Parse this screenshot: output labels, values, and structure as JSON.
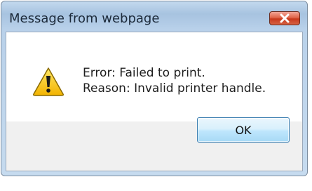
{
  "dialog": {
    "title": "Message from webpage",
    "close_icon": "close-icon",
    "message_icon": "warning-icon",
    "message_line1": "Error: Failed to print.",
    "message_line2": "Reason: Invalid printer handle.",
    "ok_label": "OK"
  },
  "colors": {
    "close_button": "#c8391c",
    "ok_button_border": "#3c7fb1",
    "warning_yellow": "#f5c400"
  }
}
